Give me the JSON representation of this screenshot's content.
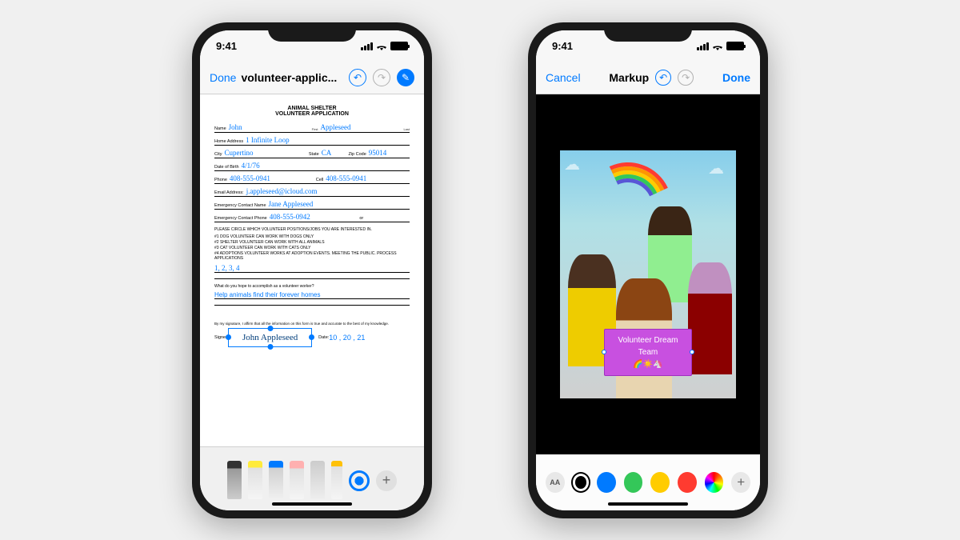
{
  "status": {
    "time": "9:41"
  },
  "phone1": {
    "nav": {
      "done": "Done",
      "title": "volunteer-applic..."
    },
    "doc": {
      "header1": "ANIMAL SHELTER",
      "header2": "VOLUNTEER APPLICATION",
      "name_label": "Name",
      "first_name": "John",
      "first_sub": "First",
      "last_name": "Appleseed",
      "last_sub": "Last",
      "addr_label": "Home Address",
      "addr": "1 Infinite Loop",
      "city_label": "City",
      "city": "Cupertino",
      "state_label": "State",
      "state": "CA",
      "zip_label": "Zip Code",
      "zip": "95014",
      "dob_label": "Date of Birth",
      "dob": "4/1/76",
      "phone_label": "Phone",
      "phone": "408-555-0941",
      "cell_label": "Cell",
      "cell": "408-555-0941",
      "email_label": "Email Address:",
      "email": "j.appleseed@icloud.com",
      "emerg_name_label": "Emergency Contact Name",
      "emerg_name": "Jane Appleseed",
      "emerg_phone_label": "Emergency Contact Phone",
      "emerg_phone": "408-555-0942",
      "emerg_or": "or",
      "circle_text": "PLEASE CIRCLE WHICH VOLUNTEER POSITIONS/JOBS YOU ARE INTERESTED IN.",
      "opt1": "#1 DOG VOLUNTEER CAN WORK WITH DOGS ONLY",
      "opt2": "#2 SHELTER VOLUNTEER CAN WORK WITH ALL ANIMALS",
      "opt3": "#3 CAT VOLUNTEER CAN WORK WITH CATS ONLY",
      "opt4": "#4 ADOPTIONS VOLUNTEER WORKS AT ADOPTION EVENTS. MEETING THE PUBLIC. PROCESS APPLICATIONS",
      "choices": "1, 2, 3, 4",
      "accomplish_q": "What do you hope to accomplish as a volunteer worker?",
      "accomplish_a": "Help animals find their forever homes",
      "affirm": "By my signature, I affirm that all the information on this form is true and accurate to the best of my knowledge.",
      "signed_label": "Signed",
      "signature": "John Appleseed",
      "date_label": "Date:",
      "date": "10 , 20 , 21"
    }
  },
  "phone2": {
    "nav": {
      "cancel": "Cancel",
      "title": "Markup",
      "done": "Done"
    },
    "caption": {
      "line1": "Volunteer Dream Team",
      "line2": "🌈☀️🦄"
    },
    "colorbar": {
      "text_label": "AA"
    }
  }
}
